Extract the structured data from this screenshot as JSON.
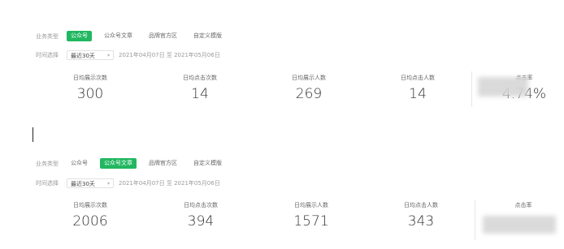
{
  "panels": [
    {
      "business_type_label": "业务类型",
      "segments": [
        "公众号",
        "公众号文章",
        "品牌官方区",
        "自定义模版"
      ],
      "selected_segment": 0,
      "time_label": "时间选择",
      "time_select_value": "最近30天",
      "date_range": "2021年04月07日 至 2021年05月06日",
      "stats": [
        {
          "label": "日均展示次数",
          "value": "300"
        },
        {
          "label": "日均点击次数",
          "value": "14"
        },
        {
          "label": "日均展示人数",
          "value": "269"
        },
        {
          "label": "日均点击人数",
          "value": "14"
        },
        {
          "label": "点击率",
          "value": "4.74%"
        }
      ]
    },
    {
      "business_type_label": "业务类型",
      "segments": [
        "公众号",
        "公众号文章",
        "品牌官方区",
        "自定义模版"
      ],
      "selected_segment": 1,
      "time_label": "时间选择",
      "time_select_value": "最近30天",
      "date_range": "2021年04月07日 至 2021年05月06日",
      "stats": [
        {
          "label": "日均展示次数",
          "value": "2006"
        },
        {
          "label": "日均点击次数",
          "value": "394"
        },
        {
          "label": "日均展示人数",
          "value": "1571"
        },
        {
          "label": "日均点击人数",
          "value": "343"
        },
        {
          "label": "点击率",
          "value": ""
        }
      ]
    }
  ],
  "colors": {
    "accent": "#21b760",
    "text": "#333333",
    "muted": "#9a9a9a"
  },
  "icons": {
    "select_chevron": "chevron-down-icon"
  }
}
